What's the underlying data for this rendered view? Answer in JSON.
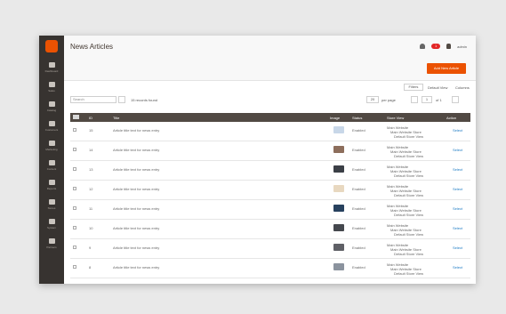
{
  "colors": {
    "accent": "#eb5202",
    "sidebar": "#373330",
    "link": "#1979c3"
  },
  "page": {
    "title": "News Articles"
  },
  "header": {
    "alert_count": "1",
    "user": "admin"
  },
  "actions": {
    "primary": "Add New Article"
  },
  "toolbar": {
    "search_placeholder": "Search",
    "records": "15 records found",
    "filters_label": "Filters",
    "default_view": "Default View",
    "columns_label": "Columns",
    "per_page_value": "20",
    "per_page_label": "per page",
    "page_value": "1",
    "page_of": "of 1"
  },
  "table": {
    "headers": [
      "ID",
      "Title",
      "Image",
      "Status",
      "Store View",
      "Action"
    ],
    "rows": [
      {
        "id": "15",
        "title": "Article title text for news entry",
        "status": "Enabled",
        "edit": "Select",
        "thumb": "thumb-1"
      },
      {
        "id": "14",
        "title": "Article title text for news entry",
        "status": "Enabled",
        "edit": "Select",
        "thumb": "thumb-2"
      },
      {
        "id": "13",
        "title": "Article title text for news entry",
        "status": "Enabled",
        "edit": "Select",
        "thumb": "thumb-3"
      },
      {
        "id": "12",
        "title": "Article title text for news entry",
        "status": "Enabled",
        "edit": "Select",
        "thumb": "thumb-4"
      },
      {
        "id": "11",
        "title": "Article title text for news entry",
        "status": "Enabled",
        "edit": "Select",
        "thumb": "thumb-5"
      },
      {
        "id": "10",
        "title": "Article title text for news entry",
        "status": "Enabled",
        "edit": "Select",
        "thumb": "thumb-6"
      },
      {
        "id": "9",
        "title": "Article title text for news entry",
        "status": "Enabled",
        "edit": "Select",
        "thumb": "thumb-7"
      },
      {
        "id": "8",
        "title": "Article title text for news entry",
        "status": "Enabled",
        "edit": "Select",
        "thumb": "thumb-8"
      }
    ],
    "store_view": [
      "Main Website",
      "Main Website Store",
      "Default Store View"
    ]
  },
  "sidebar": {
    "items": [
      {
        "label": "Dashboard",
        "icon": "dashboard-icon"
      },
      {
        "label": "Sales",
        "icon": "dollar-icon"
      },
      {
        "label": "Catalog",
        "icon": "cube-icon"
      },
      {
        "label": "Customers",
        "icon": "person-icon"
      },
      {
        "label": "Marketing",
        "icon": "megaphone-icon"
      },
      {
        "label": "Content",
        "icon": "layout-icon"
      },
      {
        "label": "Reports",
        "icon": "bar-chart-icon"
      },
      {
        "label": "Stores",
        "icon": "store-icon"
      },
      {
        "label": "System",
        "icon": "gear-icon"
      },
      {
        "label": "Partners",
        "icon": "box-icon"
      }
    ]
  }
}
